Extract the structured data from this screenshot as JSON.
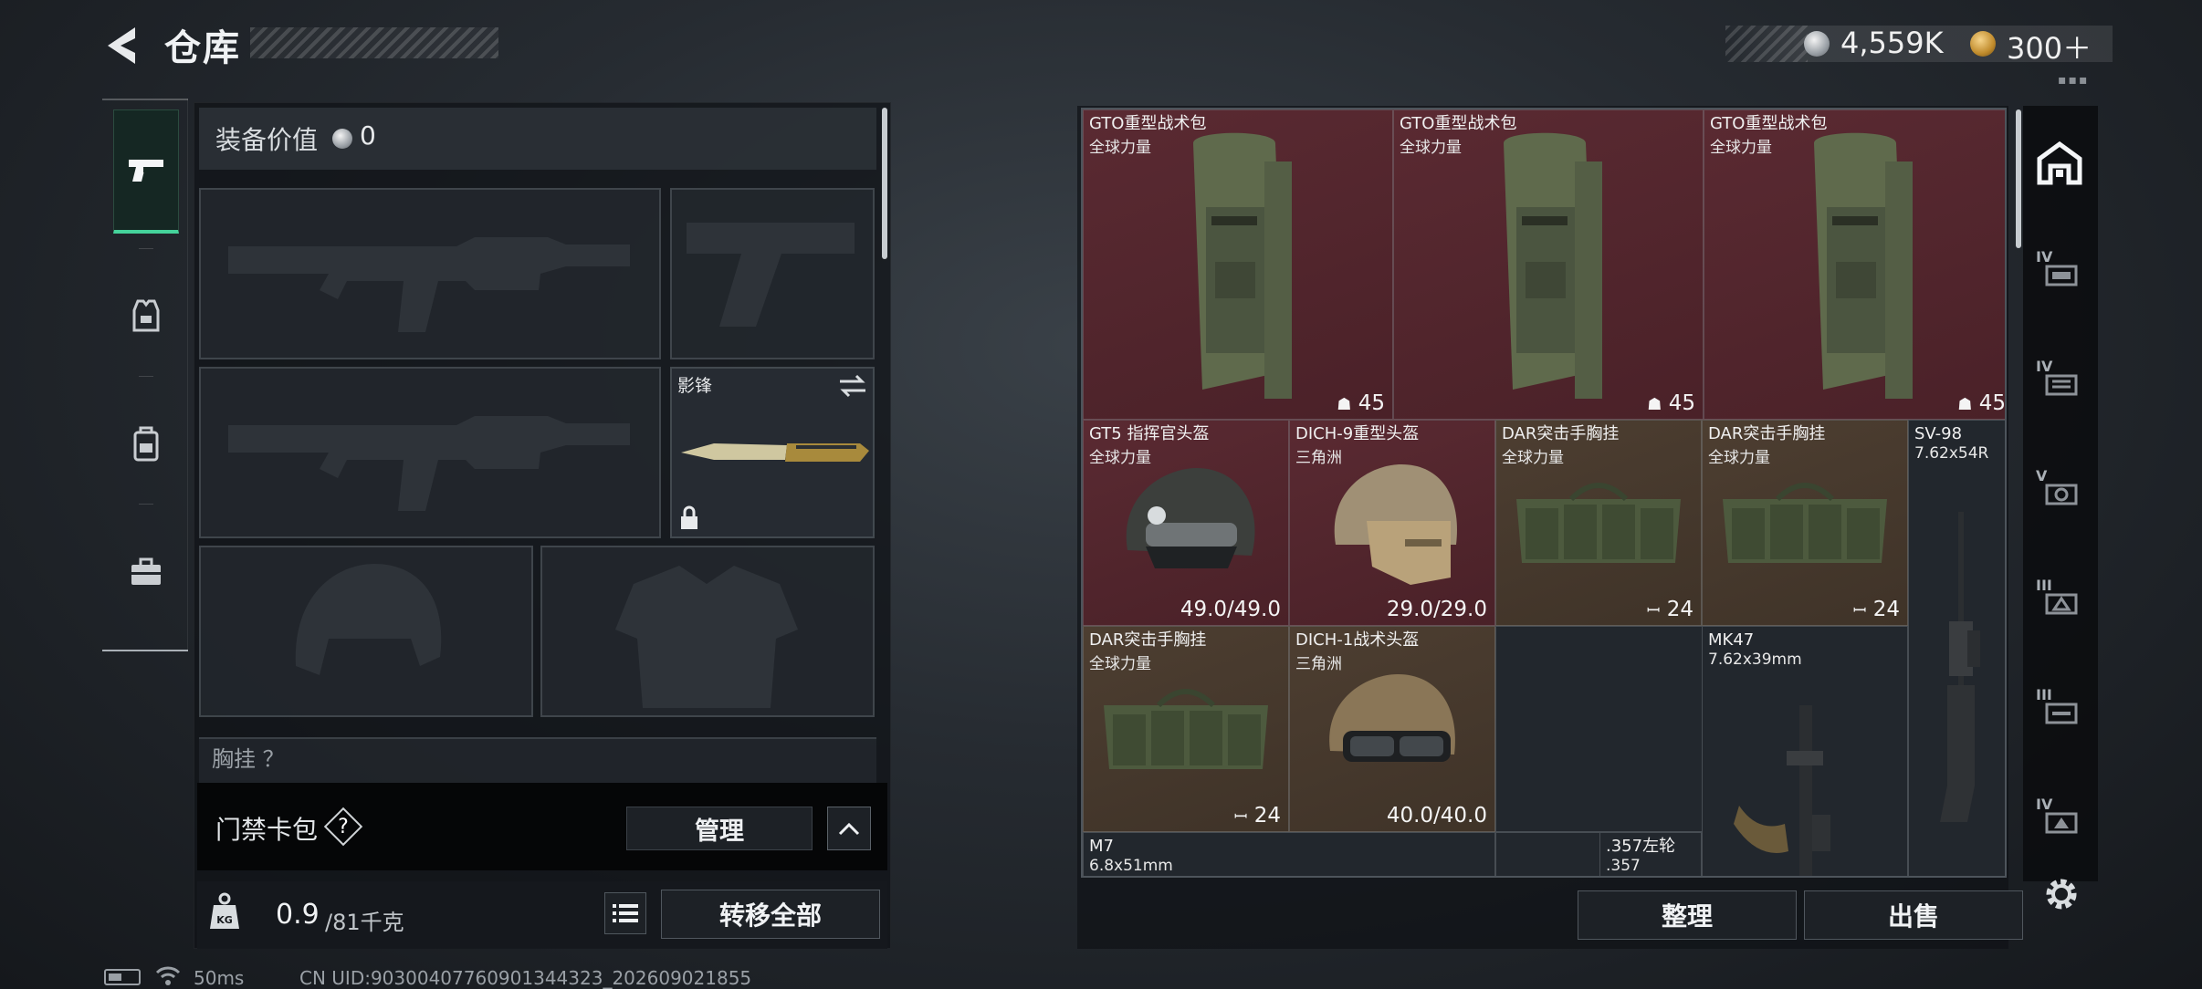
{
  "header": {
    "title": "仓库",
    "silver_amount": "4,559K",
    "gold_amount": "300＋",
    "tiny_dots": "▪▪▪"
  },
  "left_rail": {
    "items": [
      {
        "icon": "pistol-icon",
        "active": true
      },
      {
        "icon": "vest-icon",
        "active": false
      },
      {
        "icon": "backpack-icon",
        "active": false
      },
      {
        "icon": "toolbox-icon",
        "active": false
      }
    ]
  },
  "loadout": {
    "equip_value_label": "装备价值",
    "equip_value": "0",
    "melee_label": "影锋",
    "extra_slot_label": "胸挂 ？",
    "access_card_label": "门禁卡包",
    "help_glyph": "?",
    "manage_label": "管理",
    "weight_current": "0.9",
    "weight_max": "/81千克",
    "weight_icon_text": "KG",
    "transfer_all_label": "转移全部"
  },
  "status": {
    "ping": "50ms",
    "uid": "CN UID:90300407760901344323_202609021855"
  },
  "storage": {
    "items": [
      {
        "name": "GTO重型战术包",
        "sub": "全球力量",
        "stat": "45",
        "stat_icon": "backpack-capacity-icon",
        "color": "red"
      },
      {
        "name": "GTO重型战术包",
        "sub": "全球力量",
        "stat": "45",
        "stat_icon": "backpack-capacity-icon",
        "color": "red"
      },
      {
        "name": "GTO重型战术包",
        "sub": "全球力量",
        "stat": "45",
        "stat_icon": "backpack-capacity-icon",
        "color": "red"
      },
      {
        "name": "GT5 指挥官头盔",
        "sub": "全球力量",
        "stat": "49.0/49.0",
        "color": "red"
      },
      {
        "name": "DICH-9重型头盔",
        "sub": "三角洲",
        "stat": "29.0/29.0",
        "color": "red"
      },
      {
        "name": "DAR突击手胸挂",
        "sub": "全球力量",
        "stat": "24",
        "stat_icon": "rig-capacity-icon",
        "color": "brown"
      },
      {
        "name": "DAR突击手胸挂",
        "sub": "全球力量",
        "stat": "24",
        "stat_icon": "rig-capacity-icon",
        "color": "brown"
      },
      {
        "name": "SV-98",
        "sub": "7.62x54R",
        "color": "dark"
      },
      {
        "name": "DAR突击手胸挂",
        "sub": "全球力量",
        "stat": "24",
        "stat_icon": "rig-capacity-icon",
        "color": "brown"
      },
      {
        "name": "DICH-1战术头盔",
        "sub": "三角洲",
        "stat": "40.0/40.0",
        "color": "brown"
      },
      {
        "name": "MK47",
        "sub": "7.62x39mm",
        "color": "dark"
      },
      {
        "name": "M7",
        "sub": "6.8x51mm",
        "color": "dark"
      },
      {
        "name": ".357左轮",
        "sub": ".357",
        "color": "dark"
      }
    ],
    "sort_label": "整理",
    "sell_label": "出售"
  },
  "right_rail": {
    "categories": [
      {
        "icon": "home-storage-icon",
        "tier": ""
      },
      {
        "icon": "storage-tab-icon",
        "tier": "IV"
      },
      {
        "icon": "storage-tab-icon",
        "tier": "IV"
      },
      {
        "icon": "storage-tab-icon",
        "tier": "V"
      },
      {
        "icon": "storage-tab-icon",
        "tier": "III"
      },
      {
        "icon": "storage-tab-icon",
        "tier": "III"
      },
      {
        "icon": "storage-tab-icon",
        "tier": "IV"
      }
    ]
  },
  "colors": {
    "accent_green": "#45d39b",
    "rarity_red": "#5a2a32",
    "rarity_brown": "#4d3e31"
  }
}
